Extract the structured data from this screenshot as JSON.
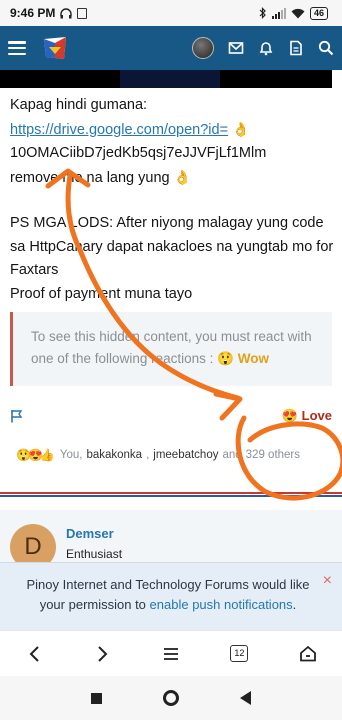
{
  "status_bar": {
    "time": "9:46 PM",
    "battery": "46"
  },
  "app_bar": {
    "menu_icon": "hamburger-icon",
    "logo_icon": "site-logo",
    "icons": [
      "avatar",
      "mail-icon",
      "bell-icon",
      "document-icon",
      "search-icon"
    ]
  },
  "post": {
    "line1": "Kapag hindi gumana:",
    "link": "https://drive.google.com/open?id=",
    "code": "10OMACiibD7jedKb5qsj7eJJVFjLf1Mlm",
    "line3": "remove mo na lang yung",
    "ps_line": "PS MGA LODS: After niyong malagay yung code sa HttpCanary dapat nakacloes na yungtab mo for Faxtars",
    "proof_line": "Proof of payment muna tayo",
    "emoji_ok": "👌"
  },
  "hidden_content": {
    "text": "To see this hidden content, you must react with one of the following reactions :",
    "emoji": "😲",
    "reaction": "Wow"
  },
  "reaction_bar": {
    "love_emoji": "😍",
    "love_label": "Love"
  },
  "reactors": {
    "emojis": "😲😍👍",
    "you": "You,",
    "name1": "bakakonka",
    "name2": "jmeebatchoy",
    "and": "and",
    "others": "329 others"
  },
  "second_post": {
    "avatar_letter": "D",
    "username": "Demser",
    "user_title": "Enthusiast"
  },
  "push_notice": {
    "text_before": "Pinoy Internet and Technology Forums would like your permission to",
    "link": "enable push notifications",
    "text_after": ".",
    "close": "×"
  },
  "browser_bar": {
    "tab_count": "12"
  },
  "colors": {
    "appbar": "#185886",
    "link": "#2577b1",
    "annotation": "#f0731f",
    "love": "#b0291e",
    "wow": "#e0a11b"
  }
}
